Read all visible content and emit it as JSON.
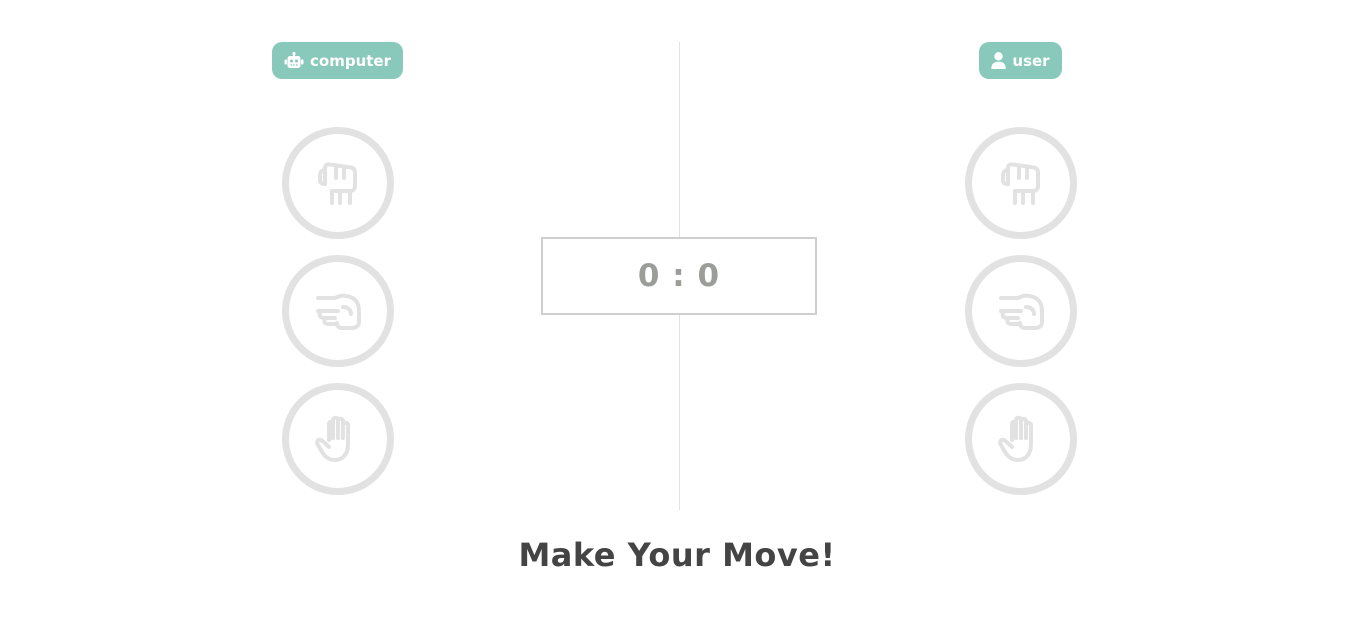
{
  "players": {
    "computer": {
      "label": "computer",
      "icon": "robot-icon"
    },
    "user": {
      "label": "user",
      "icon": "user-icon"
    }
  },
  "choices": [
    {
      "name": "rock",
      "icon": "rock-fist-icon"
    },
    {
      "name": "scissors",
      "icon": "scissors-hand-icon"
    },
    {
      "name": "paper",
      "icon": "paper-hand-icon"
    }
  ],
  "score": {
    "computer": "0",
    "separator": " : ",
    "user": "0"
  },
  "message": "Make Your Move!",
  "colors": {
    "badge": "#88c9bb",
    "badge_text": "#ffffff",
    "choice_ring": "#e2e2e2",
    "score_text": "#9a9d98",
    "message_text": "#444444",
    "divider": "#e2e2e2"
  }
}
